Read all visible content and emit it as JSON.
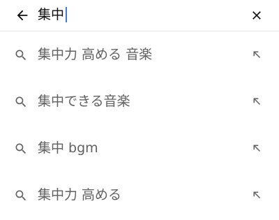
{
  "search": {
    "query": "集中"
  },
  "icons": {
    "back": "arrow-back-icon",
    "clear": "close-icon",
    "suggestion": "search-icon",
    "fill": "arrow-up-left-icon"
  },
  "colors": {
    "caret": "#3c7be7",
    "suggestion_text": "#606060",
    "icon": "#606060"
  },
  "suggestions": [
    {
      "label": "集中力 高める 音楽"
    },
    {
      "label": "集中できる音楽"
    },
    {
      "label": "集中 bgm"
    },
    {
      "label": "集中力 高める"
    }
  ]
}
